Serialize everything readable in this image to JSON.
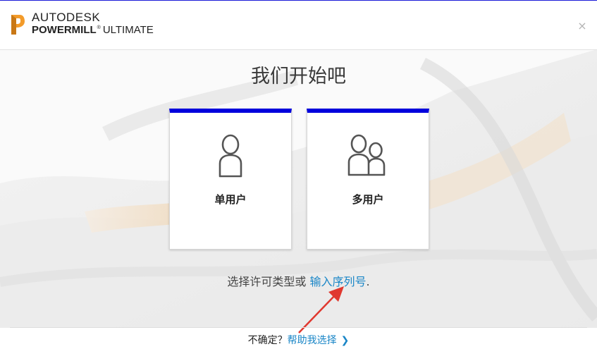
{
  "header": {
    "brand_top": "AUTODESK",
    "brand_product_bold": "POWERMILL",
    "brand_tm": "®",
    "brand_product_suffix": "ULTIMATE",
    "close_label": "×"
  },
  "main": {
    "title": "我们开始吧",
    "cards": [
      {
        "label": "单用户",
        "icon": "single-user-icon"
      },
      {
        "label": "多用户",
        "icon": "multi-user-icon"
      }
    ],
    "choose_text": "选择许可类型或",
    "serial_link": "输入序列号",
    "period": "."
  },
  "footer": {
    "unsure_text": "不确定？",
    "help_link": "帮助我选择",
    "chevron": "❯"
  },
  "colors": {
    "accent_bar": "#0000dd",
    "link": "#1a86c7",
    "annotation_arrow": "#e0382f"
  }
}
